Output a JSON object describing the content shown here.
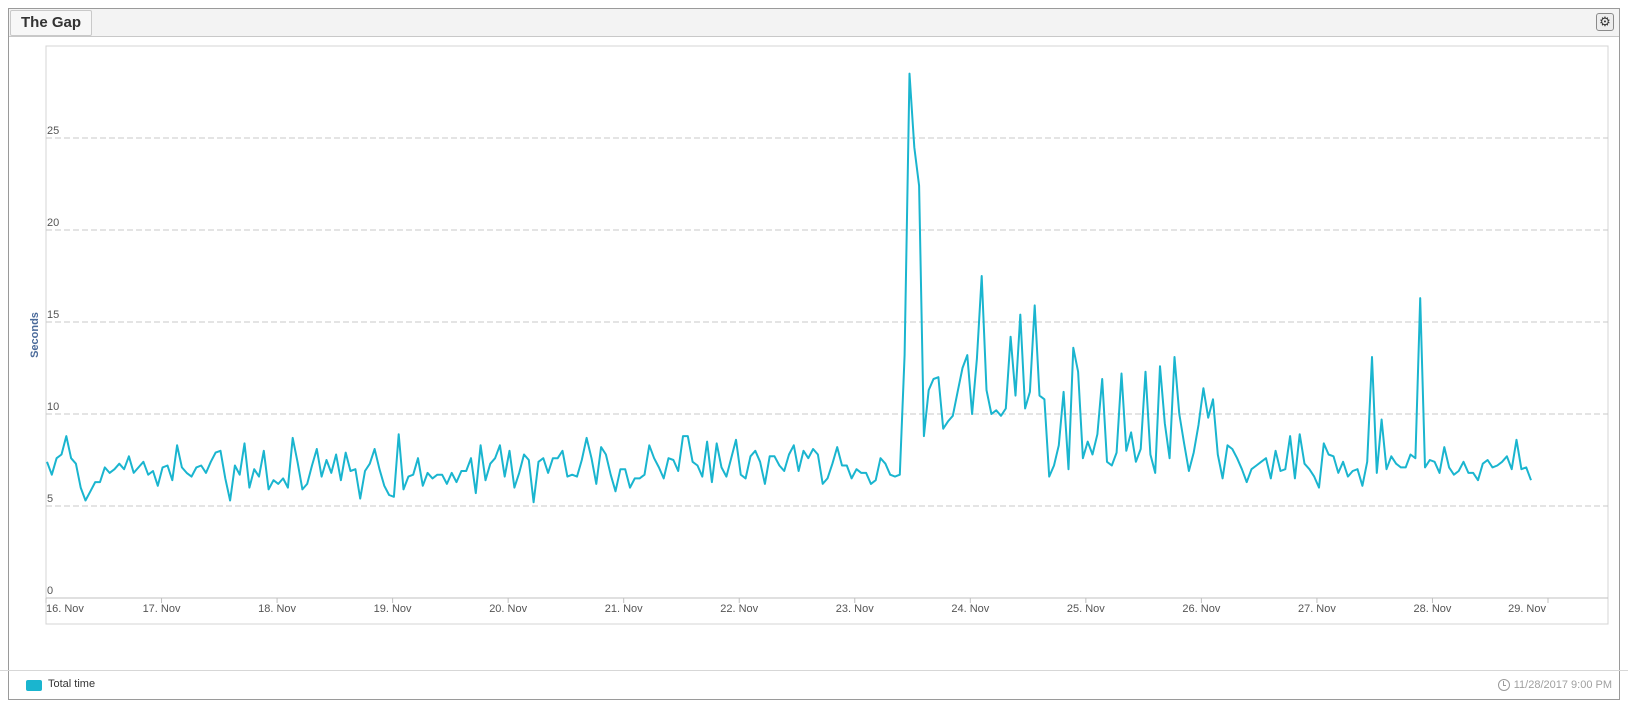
{
  "panel": {
    "title": "The Gap"
  },
  "footer": {
    "legend_label": "Total time",
    "timestamp": "11/28/2017 9:00 PM"
  },
  "icons": {
    "settings": "gear-icon",
    "timestamp": "clock-icon"
  },
  "colors": {
    "series": "#1ab5cf",
    "grid": "#c8c8c8"
  },
  "chart_data": {
    "type": "line",
    "title": "",
    "ylabel": "Seconds",
    "xlabel": "",
    "ylim": [
      0,
      30
    ],
    "yticks": [
      0,
      5,
      10,
      15,
      20,
      25
    ],
    "xlim": [
      "2017-11-16",
      "2017-11-29"
    ],
    "xticks": [
      "16. Nov",
      "17. Nov",
      "18. Nov",
      "19. Nov",
      "20. Nov",
      "21. Nov",
      "22. Nov",
      "23. Nov",
      "24. Nov",
      "25. Nov",
      "26. Nov",
      "27. Nov",
      "28. Nov",
      "29. Nov"
    ],
    "x_start": "2017-11-16",
    "x_end": "2017-11-29",
    "legend": "bottom-left",
    "grid": true,
    "series": [
      {
        "name": "Total time",
        "values": [
          7.4,
          6.7,
          7.6,
          7.8,
          8.8,
          7.6,
          7.3,
          6.0,
          5.3,
          5.8,
          6.3,
          6.3,
          7.1,
          6.8,
          7.0,
          7.3,
          7.0,
          7.7,
          6.8,
          7.1,
          7.4,
          6.7,
          6.9,
          6.1,
          7.1,
          7.2,
          6.4,
          8.3,
          7.1,
          6.8,
          6.6,
          7.1,
          7.2,
          6.8,
          7.4,
          7.9,
          8.0,
          6.5,
          5.3,
          7.2,
          6.7,
          8.4,
          6.0,
          7.0,
          6.6,
          8.0,
          5.9,
          6.4,
          6.2,
          6.5,
          6.0,
          8.7,
          7.4,
          5.9,
          6.2,
          7.2,
          8.1,
          6.6,
          7.5,
          6.8,
          7.8,
          6.4,
          7.9,
          6.9,
          7.0,
          5.4,
          6.9,
          7.3,
          8.1,
          7.0,
          6.1,
          5.6,
          5.5,
          8.9,
          5.9,
          6.6,
          6.7,
          7.6,
          6.1,
          6.8,
          6.5,
          6.7,
          6.7,
          6.2,
          6.8,
          6.3,
          6.9,
          6.9,
          7.6,
          5.7,
          8.3,
          6.4,
          7.3,
          7.6,
          8.3,
          6.6,
          8.0,
          6.0,
          6.8,
          7.8,
          7.5,
          5.2,
          7.4,
          7.6,
          6.8,
          7.6,
          7.6,
          8.0,
          6.6,
          6.7,
          6.6,
          7.5,
          8.7,
          7.6,
          6.2,
          8.2,
          7.8,
          6.7,
          5.8,
          7.0,
          7.0,
          6.0,
          6.5,
          6.5,
          6.7,
          8.3,
          7.6,
          7.1,
          6.5,
          7.6,
          7.5,
          6.9,
          8.8,
          8.8,
          7.4,
          7.2,
          6.6,
          8.5,
          6.3,
          8.4,
          7.1,
          6.6,
          7.6,
          8.6,
          6.7,
          6.5,
          7.7,
          8.0,
          7.4,
          6.2,
          7.7,
          7.7,
          7.2,
          6.9,
          7.8,
          8.3,
          6.9,
          8.0,
          7.6,
          8.1,
          7.8,
          6.2,
          6.5,
          7.3,
          8.2,
          7.2,
          7.2,
          6.5,
          7.0,
          6.8,
          6.8,
          6.2,
          6.4,
          7.6,
          7.3,
          6.7,
          6.6,
          6.7,
          13.2,
          28.5,
          24.5,
          22.4,
          8.8,
          11.3,
          11.9,
          12.0,
          9.2,
          9.6,
          9.9,
          11.2,
          12.5,
          13.2,
          10.0,
          13.0,
          17.5,
          11.3,
          10.0,
          10.2,
          9.9,
          10.3,
          14.2,
          11.0,
          15.4,
          10.3,
          11.2,
          15.9,
          11.0,
          10.8,
          6.6,
          7.2,
          8.3,
          11.2,
          7.0,
          13.6,
          12.3,
          7.6,
          8.5,
          7.8,
          8.9,
          11.9,
          7.4,
          7.2,
          7.9,
          12.2,
          8.0,
          9.0,
          7.4,
          8.1,
          12.3,
          7.8,
          6.8,
          12.6,
          9.5,
          7.6,
          13.1,
          10.0,
          8.4,
          6.9,
          7.9,
          9.4,
          11.4,
          9.8,
          10.8,
          7.8,
          6.5,
          8.3,
          8.1,
          7.6,
          7.0,
          6.3,
          7.0,
          7.2,
          7.4,
          7.6,
          6.5,
          8.0,
          6.9,
          7.0,
          8.8,
          6.5,
          8.9,
          7.3,
          7.0,
          6.6,
          6.0,
          8.4,
          7.8,
          7.7,
          6.8,
          7.4,
          6.6,
          6.9,
          7.0,
          6.1,
          7.4,
          13.1,
          6.8,
          9.7,
          7.0,
          7.7,
          7.3,
          7.1,
          7.1,
          7.8,
          7.6,
          16.3,
          7.1,
          7.5,
          7.4,
          6.8,
          8.2,
          7.1,
          6.7,
          6.9,
          7.4,
          6.8,
          6.8,
          6.4,
          7.3,
          7.5,
          7.1,
          7.2,
          7.4,
          7.7,
          7.0,
          8.6,
          7.0,
          7.1,
          6.4
        ]
      }
    ]
  }
}
